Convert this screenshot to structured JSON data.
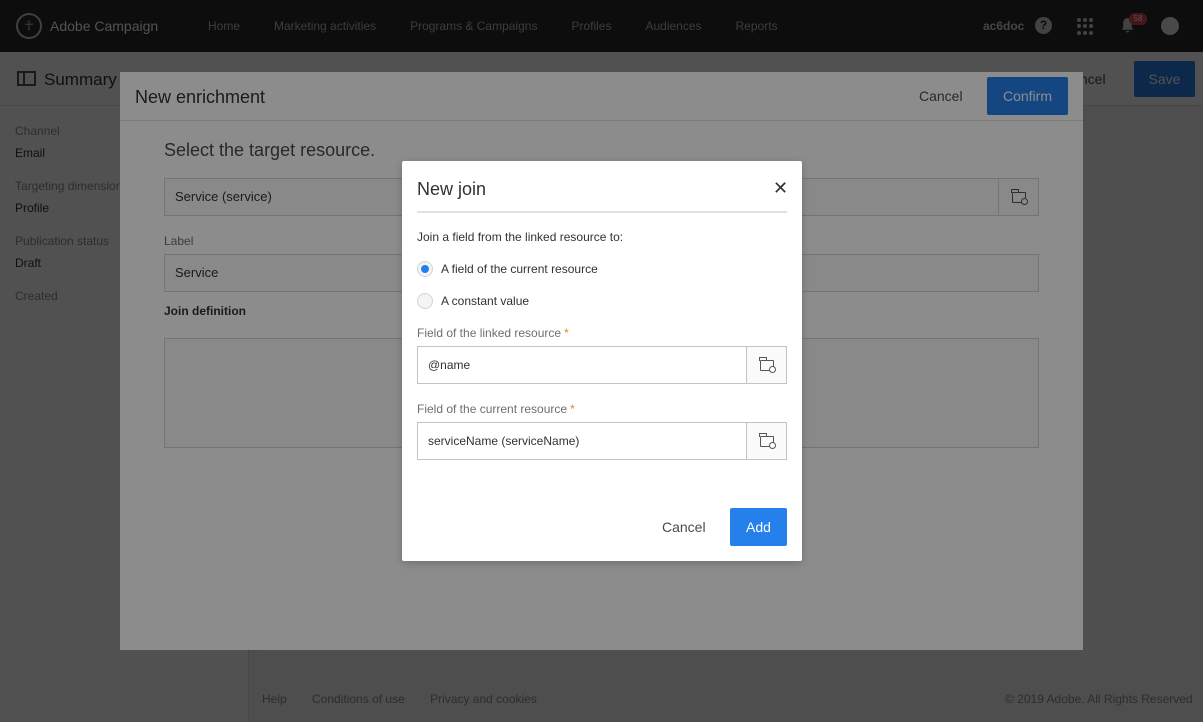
{
  "app": {
    "brand": "Adobe Campaign",
    "nav": [
      "Home",
      "Marketing activities",
      "Programs & Campaigns",
      "Profiles",
      "Audiences",
      "Reports"
    ],
    "user": "ac6doc",
    "notification_count": "58"
  },
  "page": {
    "title": "Summary",
    "cancel_label": "Cancel",
    "save_label": "Save",
    "sidebar": [
      {
        "label": "Channel",
        "value": "Email"
      },
      {
        "label": "Targeting dimension",
        "value": "Profile"
      },
      {
        "label": "Publication status",
        "value": "Draft"
      },
      {
        "label": "Created",
        "value": ""
      }
    ],
    "footer": {
      "links": [
        "Help",
        "Conditions of use",
        "Privacy and cookies"
      ],
      "copyright": "© 2019 Adobe. All Rights Reserved"
    }
  },
  "enrichment": {
    "title": "New enrichment",
    "cancel_label": "Cancel",
    "confirm_label": "Confirm",
    "subtitle": "Select the target resource.",
    "target_resource": "Service (service)",
    "label_caption": "Label",
    "label_value": "Service",
    "join_definition": "Join definition"
  },
  "join_dialog": {
    "title": "New join",
    "intro": "Join a field from the linked resource to:",
    "options": [
      {
        "label": "A field of the current resource",
        "selected": true
      },
      {
        "label": "A constant value",
        "selected": false
      }
    ],
    "linked_field_label": "Field of the linked resource",
    "linked_field_value": "@name",
    "current_field_label": "Field of the current resource",
    "current_field_value": "serviceName (serviceName)",
    "required_mark": "*",
    "cancel_label": "Cancel",
    "add_label": "Add"
  },
  "colors": {
    "accent": "#2680eb",
    "topbar": "#2c2c2c",
    "required": "#e68619"
  }
}
